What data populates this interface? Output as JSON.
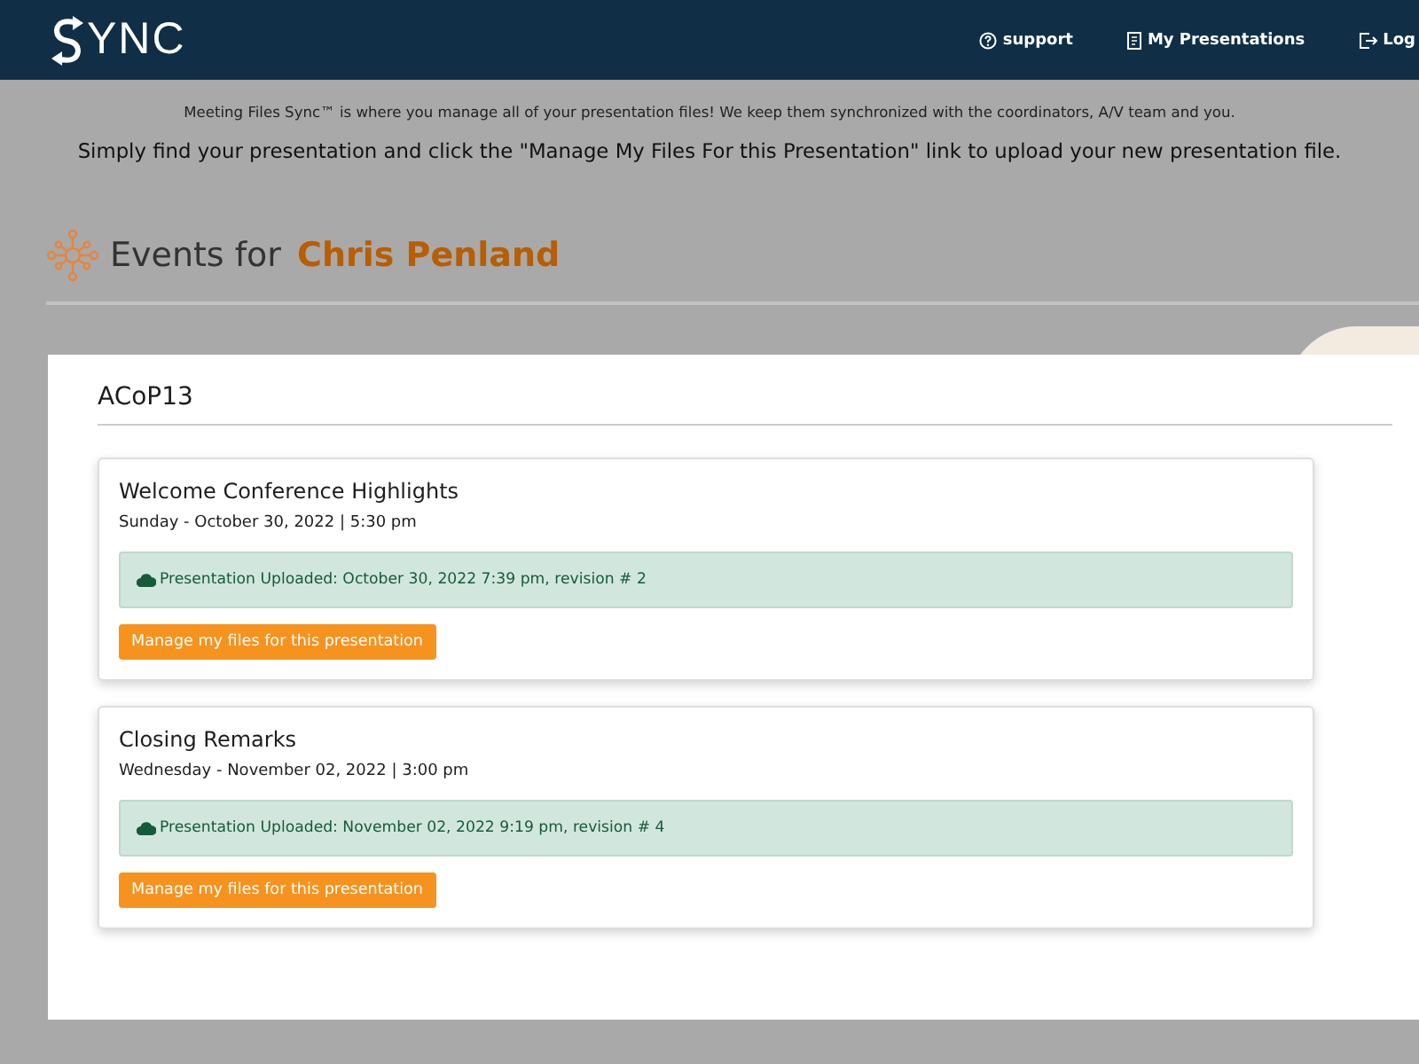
{
  "navbar": {
    "logo_text": "YNC",
    "links": [
      {
        "kind": "help",
        "label": "support"
      },
      {
        "kind": "document",
        "label": "My Presentations"
      },
      {
        "kind": "logout",
        "label": "Log"
      }
    ]
  },
  "intro": {
    "note": "Meeting Files Sync™ is where you manage all of your presentation files! We keep them synchronized with the coordinators, A/V team and you.",
    "instruction": "Simply find your presentation and click the \"Manage My Files For this Presentation\" link to upload your new presentation file."
  },
  "heading": {
    "prefix": "Events for",
    "name": "Chris Penland"
  },
  "event": {
    "title": "ACoP13",
    "sessions": [
      {
        "title": "Welcome Conference Highlights",
        "when": "Sunday - October 30, 2022 | 5:30 pm",
        "status": "Presentation Uploaded: October 30, 2022 7:39 pm, revision # 2",
        "button": "Manage my files for this presentation"
      },
      {
        "title": "Closing Remarks",
        "when": "Wednesday - November 02, 2022 | 3:00 pm",
        "status": "Presentation Uploaded: November 02, 2022 9:19 pm, revision # 4",
        "button": "Manage my files for this presentation"
      }
    ]
  }
}
